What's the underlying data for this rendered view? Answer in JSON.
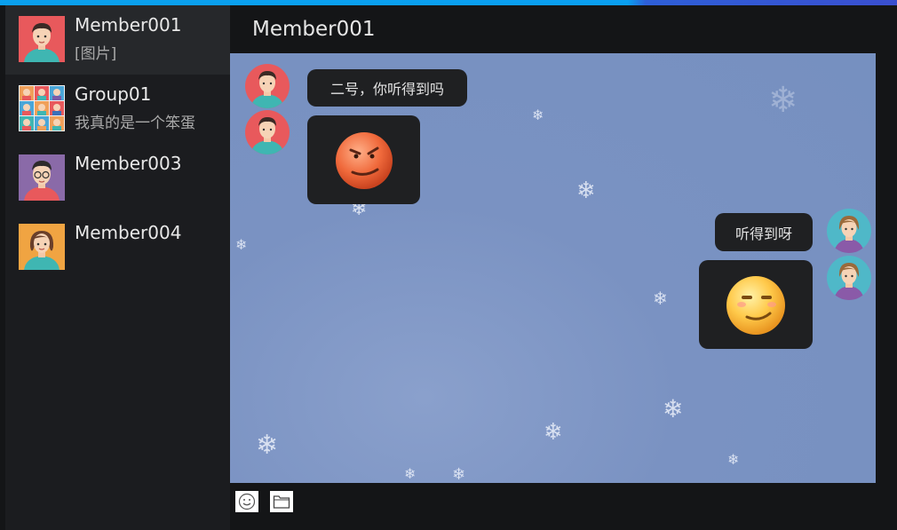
{
  "conversations": [
    {
      "name": "Member001",
      "preview": "[图片]",
      "active": true
    },
    {
      "name": "Group01",
      "preview": "我真的是一个笨蛋",
      "active": false
    },
    {
      "name": "Member003",
      "preview": "",
      "active": false
    },
    {
      "name": "Member004",
      "preview": "",
      "active": false
    }
  ],
  "chat": {
    "title": "Member001",
    "messages": [
      {
        "side": "left",
        "type": "text",
        "text": "二号，你听得到吗"
      },
      {
        "side": "left",
        "type": "image",
        "content": "grimacing-orange-emoji"
      },
      {
        "side": "right",
        "type": "text",
        "text": "听得到呀"
      },
      {
        "side": "right",
        "type": "image",
        "content": "smirking-yellow-emoji"
      }
    ]
  },
  "toolbar": {
    "buttons": [
      "emoji-icon",
      "folder-icon"
    ]
  },
  "colors": {
    "accent": "#0aa0ee",
    "chat_background": "#7a92c2",
    "bubble": "#1f2022",
    "sidebar_active": "#26282b"
  }
}
